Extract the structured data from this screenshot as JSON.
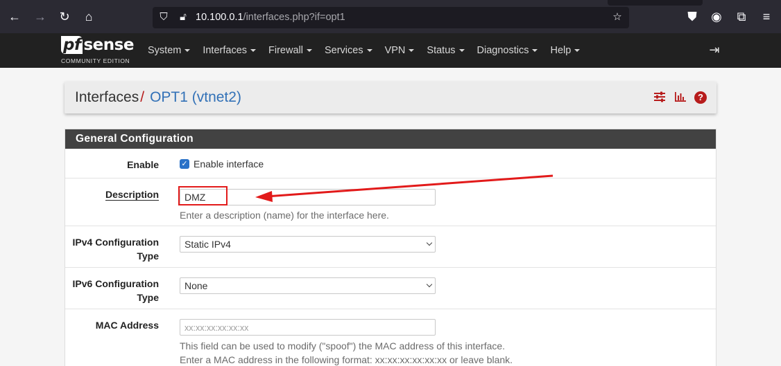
{
  "browser": {
    "url_host": "10.100.0.1",
    "url_path": "/interfaces.php?if=opt1"
  },
  "navbar": {
    "logo_main": "sense",
    "logo_pf": "pf",
    "logo_sub": "COMMUNITY EDITION",
    "menu": [
      "System",
      "Interfaces",
      "Firewall",
      "Services",
      "VPN",
      "Status",
      "Diagnostics",
      "Help"
    ]
  },
  "breadcrumb": {
    "section": "Interfaces",
    "separator": "/",
    "current": "OPT1 (vtnet2)"
  },
  "panel": {
    "title": "General Configuration",
    "enable": {
      "label": "Enable",
      "checkbox_label": "Enable interface",
      "checked": true
    },
    "description": {
      "label": "Description",
      "value": "DMZ",
      "help": "Enter a description (name) for the interface here."
    },
    "ipv4": {
      "label_line1": "IPv4 Configuration",
      "label_line2": "Type",
      "value": "Static IPv4"
    },
    "ipv6": {
      "label_line1": "IPv6 Configuration",
      "label_line2": "Type",
      "value": "None"
    },
    "mac": {
      "label": "MAC Address",
      "placeholder": "xx:xx:xx:xx:xx:xx",
      "help_line1": "This field can be used to modify (\"spoof\") the MAC address of this interface.",
      "help_line2": "Enter a MAC address in the following format: xx:xx:xx:xx:xx:xx or leave blank."
    }
  },
  "colors": {
    "accent_red": "#b71c1c",
    "link_blue": "#3271b7",
    "annotation_red": "#e21a1a"
  }
}
